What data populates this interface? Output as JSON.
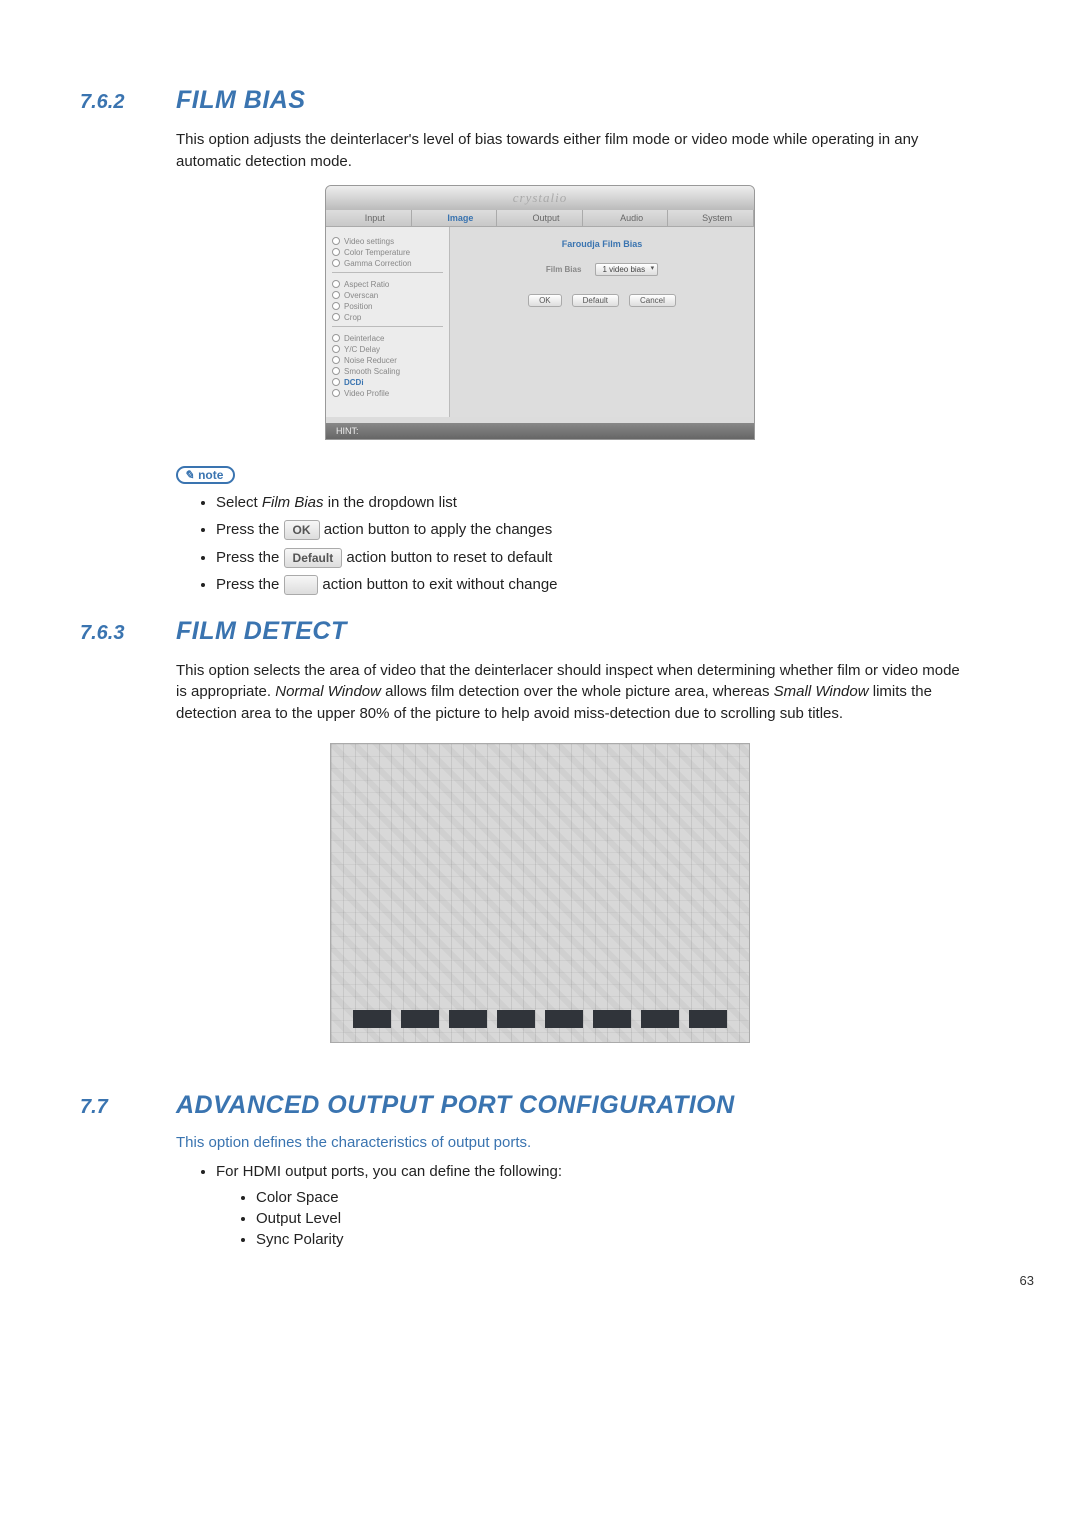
{
  "sections": {
    "s1": {
      "num": "7.6.2",
      "title": "FILM BIAS"
    },
    "s2": {
      "num": "7.6.3",
      "title": "FILM DETECT"
    },
    "s3": {
      "num": "7.7",
      "title": "ADVANCED OUTPUT PORT CONFIGURATION"
    }
  },
  "paras": {
    "p1": "This option adjusts the deinterlacer's level of bias towards either film mode or video mode while operating in any automatic detection mode.",
    "p2_a": "This option selects the area of video that the deinterlacer should inspect when determining whether film or video mode is appropriate. ",
    "p2_b": "Normal Window",
    "p2_c": " allows film detection over the whole picture area, whereas ",
    "p2_d": "Small Window",
    "p2_e": " limits the detection area to the upper 80% of the picture to help avoid miss-detection due to scrolling sub titles.",
    "p3": "This option defines the characteristics of output ports."
  },
  "ui": {
    "brand": "crystalio",
    "tabs": {
      "input": "Input",
      "image": "Image",
      "output": "Output",
      "audio": "Audio",
      "system": "System"
    },
    "sidebar": {
      "g1": [
        "Video settings",
        "Color Temperature",
        "Gamma Correction"
      ],
      "g2": [
        "Aspect Ratio",
        "Overscan",
        "Position",
        "Crop"
      ],
      "g3": [
        "Deinterlace",
        "Y/C Delay",
        "Noise Reducer",
        "Smooth Scaling",
        "DCDi",
        "Video Profile"
      ]
    },
    "panel": {
      "title": "Faroudja Film Bias",
      "label": "Film Bias",
      "select": "1 video bias",
      "ok": "OK",
      "default": "Default",
      "cancel": "Cancel"
    },
    "hint": "HINT:"
  },
  "note": {
    "badge": "note",
    "b1_a": "Select ",
    "b1_b": "Film Bias",
    "b1_c": " in the dropdown list",
    "b2_a": "Press the ",
    "b2_b": "OK",
    "b2_c": " action button to apply the changes",
    "b3_a": "Press the ",
    "b3_b": "Default",
    "b3_c": " action button to reset to default",
    "b4_a": "Press the ",
    "b4_c": " action button to exit without change"
  },
  "hdmi": {
    "lead": "For HDMI output ports, you can define the following:",
    "items": [
      "Color Space",
      "Output Level",
      "Sync Polarity"
    ]
  },
  "pageNumber": "63"
}
